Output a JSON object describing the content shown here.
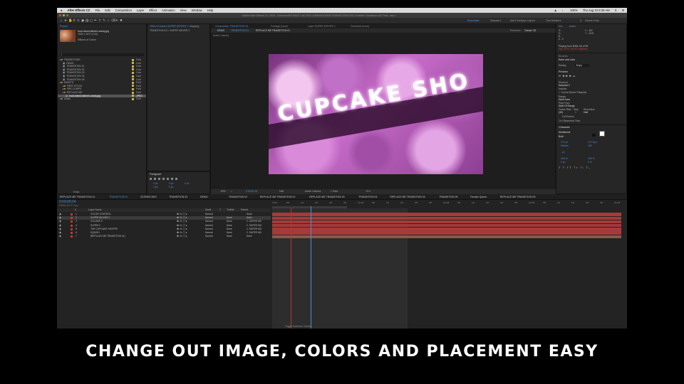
{
  "menubar": {
    "apple": "",
    "items": [
      "After Effects CC",
      "File",
      "Edit",
      "Composition",
      "Layer",
      "Effect",
      "Animation",
      "View",
      "Window",
      "Help"
    ],
    "zoom": "100%",
    "clock": "Thu Aug 10  9:36 AM"
  },
  "titlebar": {
    "text": "Adobe After Effects CC 2018 - /Volumes/EN PASS 1 ACTIVE JOBS/MODERN TRANSITIONS PAC Grabber Transitions AE Final...aep *"
  },
  "toolbar": {
    "workspaces": [
      "Essentials",
      "Standard",
      "Add Prototype Layout",
      "Two Monitors"
    ],
    "search": "Search Help"
  },
  "project": {
    "tab": "Project",
    "file_name": "food-mixed-kitchen-candy.jpg",
    "file_info": "1920 x 1107 (1.00)",
    "file_colors": "Millions of Colors",
    "items": [
      {
        "name": "TRANSITIONS",
        "type": "Fold",
        "indent": 0
      },
      {
        "name": "DEMO",
        "type": "Com",
        "indent": 1
      },
      {
        "name": "TRANSITION 01",
        "type": "Com",
        "indent": 1
      },
      {
        "name": "TRANSITION 02",
        "type": "Com",
        "indent": 1
      },
      {
        "name": "TRANSITION 03",
        "type": "Com",
        "indent": 1
      },
      {
        "name": "TRANSITION 04",
        "type": "Com",
        "indent": 1
      },
      {
        "name": "TRANSITION 05",
        "type": "Com",
        "indent": 1
      },
      {
        "name": "ASSETS",
        "type": "Fold",
        "indent": 0
      },
      {
        "name": "FREE STOCK",
        "type": "Fold",
        "indent": 1
      },
      {
        "name": "PRE COMPS",
        "type": "Fold",
        "indent": 1
      },
      {
        "name": "REPLACE ME",
        "type": "Fold",
        "indent": 1
      },
      {
        "name": "food-mixed-kitchen-candy.jpg",
        "type": "JPEG",
        "indent": 2
      },
      {
        "name": "Solids",
        "type": "Fold",
        "indent": 0
      }
    ],
    "bpc": "8 bpc"
  },
  "effect_controls": {
    "tab": "Effect Controls",
    "target": "SUPER MOVER 2",
    "sub": "TRANSITION 01 • SUPER MOVER 2",
    "mapping": "Mapping"
  },
  "paragraph": {
    "tab": "Paragraph",
    "values": [
      "0 px",
      "0 px",
      "0 px",
      "0 px",
      "0 px"
    ]
  },
  "composition": {
    "tabs": [
      "Composition TRANSITION 01",
      "Footage (none)",
      "Layer SUPER MOVER 2",
      "Flowchart (none)"
    ],
    "breadcrumbs": [
      "DEMO",
      "TRANSITION 01",
      "REPLACE ME TRANSITION 01"
    ],
    "renderer_label": "Renderer:",
    "renderer": "Classic 3D",
    "active_camera": "Active Camera",
    "title_text": "CUPCAKE SHO",
    "footer": {
      "zoom": "50%",
      "timecode": "0;00;00;15",
      "resolution": "Half",
      "camera": "Active Camera",
      "views": "1 View",
      "exposure": "+0.0"
    }
  },
  "info": {
    "tab": "Info",
    "r": "R :",
    "g": "G :",
    "b": "B :",
    "a": "A : 0",
    "x": "X : 482",
    "y": "Y : 1130",
    "line1": "Playing from RAM: All of 99",
    "line2": "Fps: 29.97 (29.97 realtime)"
  },
  "audio": {
    "tab": "Audio"
  },
  "brushes": {
    "tab": "Brushes",
    "title": "Ease and wizz"
  },
  "easing": {
    "label": "Easing",
    "value": "Expo"
  },
  "preview": {
    "tab": "Preview",
    "shortcut_label": "Shortcut",
    "shortcut": "Numpad 0",
    "include_label": "Include:",
    "cache": "Cache Before Playback",
    "range_label": "Range",
    "range": "Work Area",
    "play_from_label": "Play From",
    "play_from": "Start Of Range",
    "frame_rate_label": "Frame Rate",
    "skip_label": "Skip",
    "resolution_label": "Resolution",
    "frame_rate": "(30)",
    "skip": "0",
    "resolution": "Half",
    "full_screen": "Full Screen",
    "on_stop": "On (Spacebar) Stop:"
  },
  "character": {
    "tab": "Character",
    "font": "Montserrat",
    "style": "Bold",
    "size": "171 px",
    "leading": "171.5 px",
    "kerning": "Metrics",
    "tracking": "150",
    "stroke": "- px",
    "vscale": "100 %",
    "hscale": "100 %",
    "baseline": "0 px",
    "tsume": "0 %"
  },
  "timeline": {
    "tabs": [
      "REPLACE ME TRANSITION 01",
      "TRANSITION 01",
      "SCENES BKG",
      "TRANSITION 03",
      "DEMO",
      "TRANSITION 02",
      "REPLACE ME TRANSITION 02",
      "REPLACE ME TRANSITION 03",
      "TRANSITION 04",
      "REPLACE ME TRANSITION 04",
      "TRANSITION 05",
      "Render Queue",
      "REPLACE ME TRANSITION 05"
    ],
    "timecode": "0;00;00;04",
    "frame_info": "00004 (29.97 fps)",
    "columns": [
      "#",
      "Layer Name",
      "Mode",
      "T",
      "TrkMat",
      "Parent"
    ],
    "layers": [
      {
        "num": "1",
        "name": "COLOR CONTROL",
        "mode": "Normal",
        "trk": "",
        "parent": "None"
      },
      {
        "num": "2",
        "name": "SUPER MOVER 2",
        "mode": "Normal",
        "trk": "None",
        "parent": "None"
      },
      {
        "num": "3",
        "name": "VOLUME 3",
        "mode": "Normal",
        "trk": "None",
        "parent": "2. SUPER MO"
      },
      {
        "num": "4",
        "name": "SUPER 2",
        "mode": "Normal",
        "trk": "None",
        "parent": "2. SUPER MO"
      },
      {
        "num": "5",
        "name": "THE CUPCAKE SHOPPE",
        "mode": "Normal",
        "trk": "None",
        "parent": "2. SUPER MO"
      },
      {
        "num": "6",
        "name": "SQUISH",
        "mode": "Normal",
        "trk": "None",
        "parent": "2. SUPER MO"
      },
      {
        "num": "7",
        "name": "[REPLACE ME TRANSITION 01]",
        "mode": "Normal",
        "trk": "None",
        "parent": "None"
      }
    ],
    "ruler": [
      "0;00f",
      "05f",
      "10f",
      "15f",
      "20f",
      "25f",
      "01;00f",
      "05f",
      "10f",
      "15f",
      "20f",
      "25f",
      "02;00f",
      "05f",
      "10f",
      "15f",
      "20f",
      "25f",
      "03;00f",
      "05f",
      "10f",
      "15f",
      "20f",
      "25f",
      "04;00f"
    ],
    "toggle": "Toggle Switches / Modes"
  },
  "caption": "CHANGE OUT IMAGE, COLORS AND PLACEMENT EASY",
  "colors": {
    "accent": "#4a90d9",
    "layer_bar": "#a63a3a",
    "caption": "#ffffff"
  }
}
